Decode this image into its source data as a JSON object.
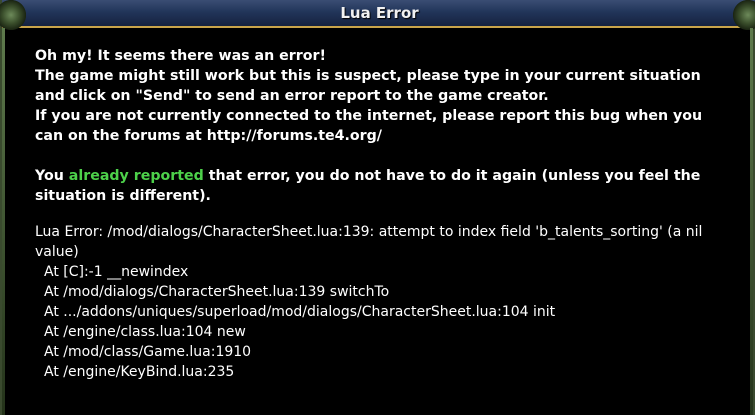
{
  "window": {
    "title": "Lua Error"
  },
  "message": {
    "line1": "Oh my! It seems there was an error!",
    "line2": "The game might still work but this is suspect, please type in your current situation and click on \"Send\" to send an error report to the game creator.",
    "line3": "If you are not currently connected to the internet, please report this bug when you can on the forums at http://forums.te4.org/",
    "reported_prefix": "You ",
    "reported_highlight": "already reported",
    "reported_suffix": " that error, you do not have to do it again (unless you feel the situation is different)."
  },
  "error": {
    "summary": "Lua Error: /mod/dialogs/CharacterSheet.lua:139: attempt to index field 'b_talents_sorting' (a nil value)",
    "trace": [
      "At [C]:-1 __newindex",
      "At /mod/dialogs/CharacterSheet.lua:139 switchTo",
      "At .../addons/uniques/superload/mod/dialogs/CharacterSheet.lua:104 init",
      "At /engine/class.lua:104 new",
      "At /mod/class/Game.lua:1910",
      "At /engine/KeyBind.lua:235"
    ]
  },
  "colors": {
    "highlight": "#4dd14a",
    "titlebar": "#22355a",
    "text": "#ffffff"
  }
}
